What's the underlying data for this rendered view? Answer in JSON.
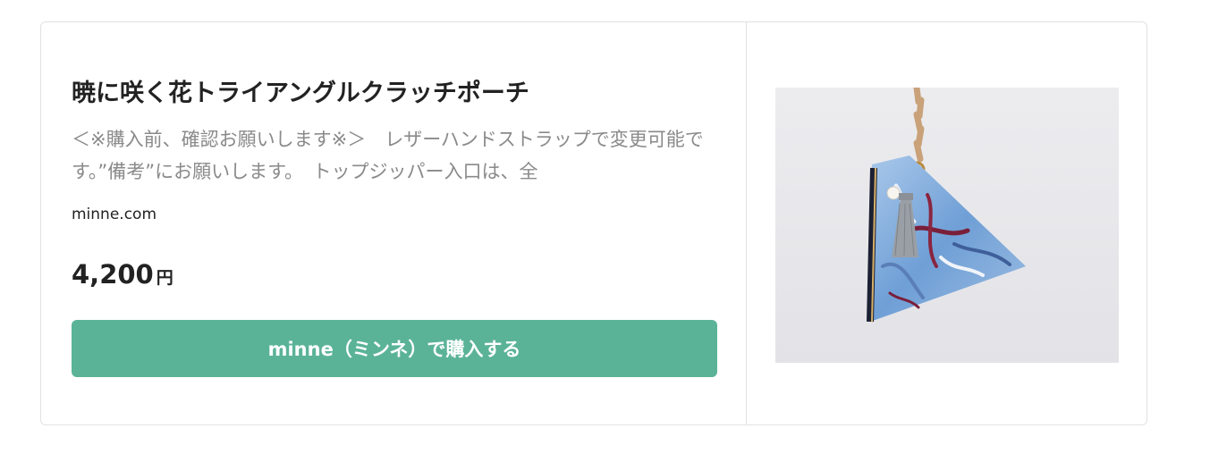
{
  "product": {
    "title": "暁に咲く花トライアングルクラッチポーチ",
    "description": "＜※購入前、確認お願いします※＞　レザーハンドストラップで変更可能です。”備考”にお願いします。　トップジッパー入口は、全",
    "domain": "minne.com",
    "price_amount": "4,200",
    "price_unit": "円",
    "buy_label": "minne（ミンネ）で購入する",
    "image_icon": "triangle-clutch-pouch-photo"
  },
  "colors": {
    "button": "#5bb397",
    "image_background": "#e9e9ec"
  }
}
